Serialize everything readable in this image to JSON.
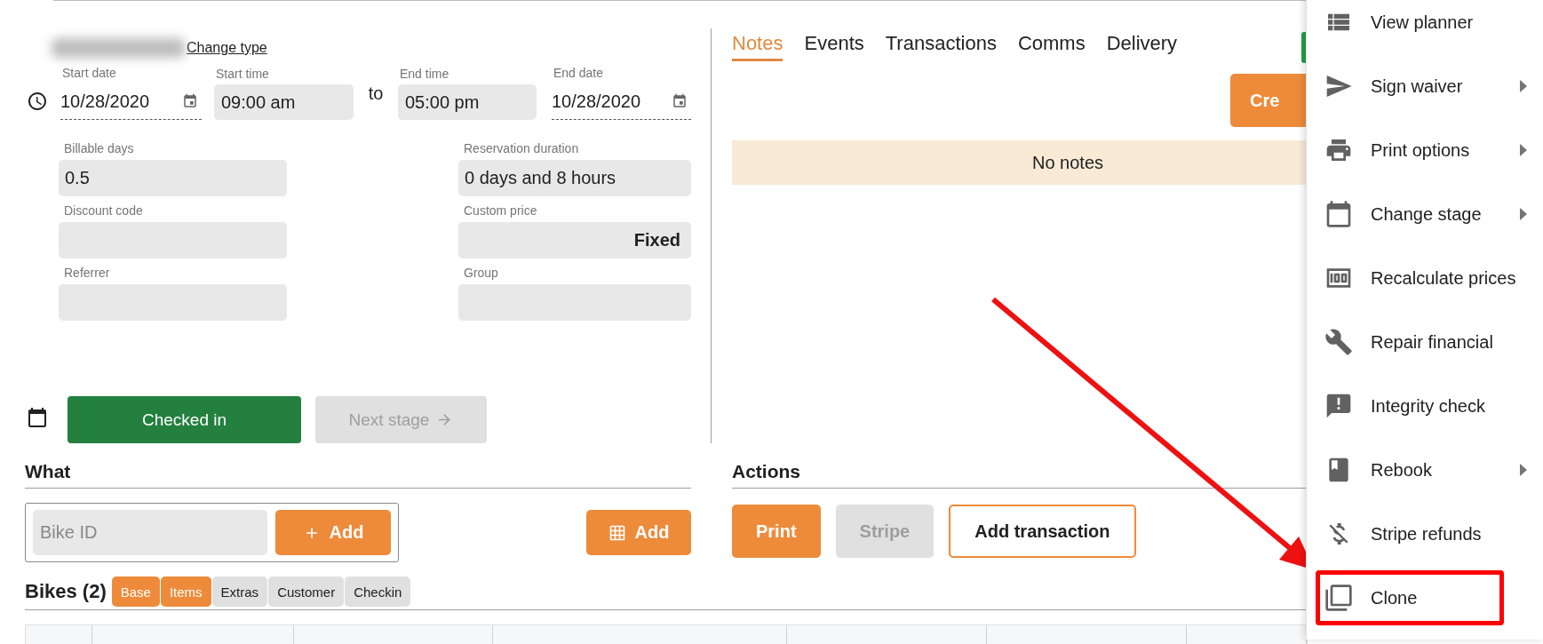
{
  "header": {
    "change_type_link": "Change type"
  },
  "schedule": {
    "start_date": {
      "label": "Start date",
      "value": "10/28/2020"
    },
    "start_time": {
      "label": "Start time",
      "value": "09:00 am"
    },
    "separator": "to",
    "end_time": {
      "label": "End time",
      "value": "05:00 pm"
    },
    "end_date": {
      "label": "End date",
      "value": "10/28/2020"
    }
  },
  "details": {
    "left": [
      {
        "kind": "text",
        "label": "Billable days",
        "value": "0.5"
      },
      {
        "kind": "text",
        "label": "Discount code"
      },
      {
        "kind": "text",
        "label": "Referrer"
      }
    ],
    "right": [
      {
        "kind": "text",
        "label": "Reservation duration",
        "value": "0 days and 8 hours"
      },
      {
        "kind": "price",
        "label": "Custom price",
        "value": "Fixed"
      },
      {
        "kind": "text",
        "label": "Group"
      }
    ]
  },
  "stage": {
    "current": "Checked in",
    "next": {
      "label": "Next stage",
      "disabled": true
    }
  },
  "what": {
    "heading": "What",
    "bike_id_placeholder": "Bike ID",
    "add_label": "Add",
    "grid_add_label": "Add"
  },
  "bikes": {
    "heading": "Bikes (2)",
    "chips": [
      {
        "label": "Base",
        "selected": true
      },
      {
        "label": "Items",
        "selected": true
      },
      {
        "label": "Extras",
        "selected": false
      },
      {
        "label": "Customer",
        "selected": false
      },
      {
        "label": "Checkin",
        "selected": false
      }
    ]
  },
  "notes_panel": {
    "tabs": [
      {
        "label": "Notes",
        "selected": true
      },
      {
        "label": "Events",
        "selected": false
      },
      {
        "label": "Transactions",
        "selected": false
      },
      {
        "label": "Comms",
        "selected": false
      },
      {
        "label": "Delivery",
        "selected": false
      }
    ],
    "create_button": "Cre",
    "empty_message": "No notes"
  },
  "actions": {
    "heading": "Actions",
    "buttons": [
      {
        "kind": "primary",
        "label": "Print"
      },
      {
        "kind": "disabled",
        "label": "Stripe"
      },
      {
        "kind": "outline",
        "label": "Add transaction"
      }
    ]
  },
  "menu": {
    "items": [
      {
        "label": "View planner",
        "has_submenu": false,
        "highlighted": false
      },
      {
        "label": "Sign waiver",
        "has_submenu": true,
        "highlighted": false
      },
      {
        "label": "Print options",
        "has_submenu": true,
        "highlighted": false
      },
      {
        "label": "Change stage",
        "has_submenu": true,
        "highlighted": false
      },
      {
        "label": "Recalculate prices",
        "has_submenu": false,
        "highlighted": false
      },
      {
        "label": "Repair financial",
        "has_submenu": false,
        "highlighted": false
      },
      {
        "label": "Integrity check",
        "has_submenu": false,
        "highlighted": false
      },
      {
        "label": "Rebook",
        "has_submenu": true,
        "highlighted": false
      },
      {
        "label": "Stripe refunds",
        "has_submenu": false,
        "highlighted": false
      },
      {
        "label": "Clone",
        "has_submenu": false,
        "highlighted": true
      }
    ]
  }
}
